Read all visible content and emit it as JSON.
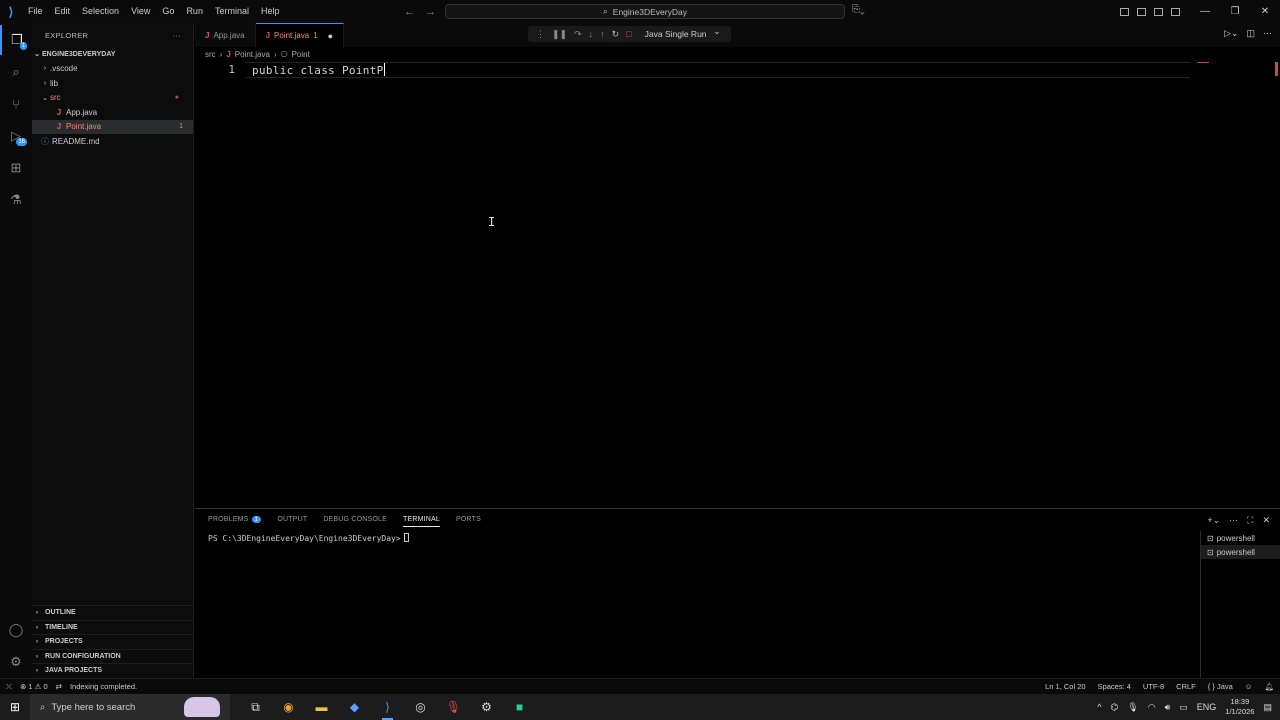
{
  "titlebar": {
    "menu": [
      "File",
      "Edit",
      "Selection",
      "View",
      "Go",
      "Run",
      "Terminal",
      "Help"
    ],
    "command_center": "Engine3DEveryDay"
  },
  "activity": {
    "explorer_badge": "1",
    "run_badge": "16"
  },
  "sidebar": {
    "title": "EXPLORER",
    "root": "ENGINE3DEVERYDAY",
    "items": [
      {
        "label": ".vscode"
      },
      {
        "label": "lib"
      },
      {
        "label": "src"
      },
      {
        "label": "App.java"
      },
      {
        "label": "Point.java",
        "badge": "1"
      },
      {
        "label": "README.md"
      }
    ],
    "sections": [
      "OUTLINE",
      "TIMELINE",
      "PROJECTS",
      "RUN CONFIGURATION",
      "JAVA PROJECTS"
    ]
  },
  "tabs": [
    {
      "label": "App.java"
    },
    {
      "label": "Point.java",
      "suffix": "1"
    }
  ],
  "debug": {
    "run_config": "Java Single Run"
  },
  "breadcrumb": {
    "folder": "src",
    "file": "Point.java",
    "symbol": "Point"
  },
  "editor": {
    "line_number": "1",
    "code": "public class PointP"
  },
  "panel": {
    "tabs": [
      "PROBLEMS",
      "OUTPUT",
      "DEBUG CONSOLE",
      "TERMINAL",
      "PORTS"
    ],
    "problems_count": "1",
    "terminal_line": "PS C:\\3DEngineEveryDay\\Engine3DEveryDay>",
    "terminals": [
      "powershell",
      "powershell"
    ]
  },
  "statusbar": {
    "errors": "1",
    "warnings": "0",
    "message": "Indexing completed.",
    "position": "Ln 1, Col 20",
    "spaces": "Spaces: 4",
    "encoding": "UTF-8",
    "eol": "CRLF",
    "language": "Java"
  },
  "taskbar": {
    "search_placeholder": "Type here to search",
    "language": "ENG",
    "time": "18:39",
    "date": "1/1/2026"
  },
  "colors": {
    "accent": "#3794ff",
    "error": "#f48771",
    "java_icon": "#e25555"
  }
}
